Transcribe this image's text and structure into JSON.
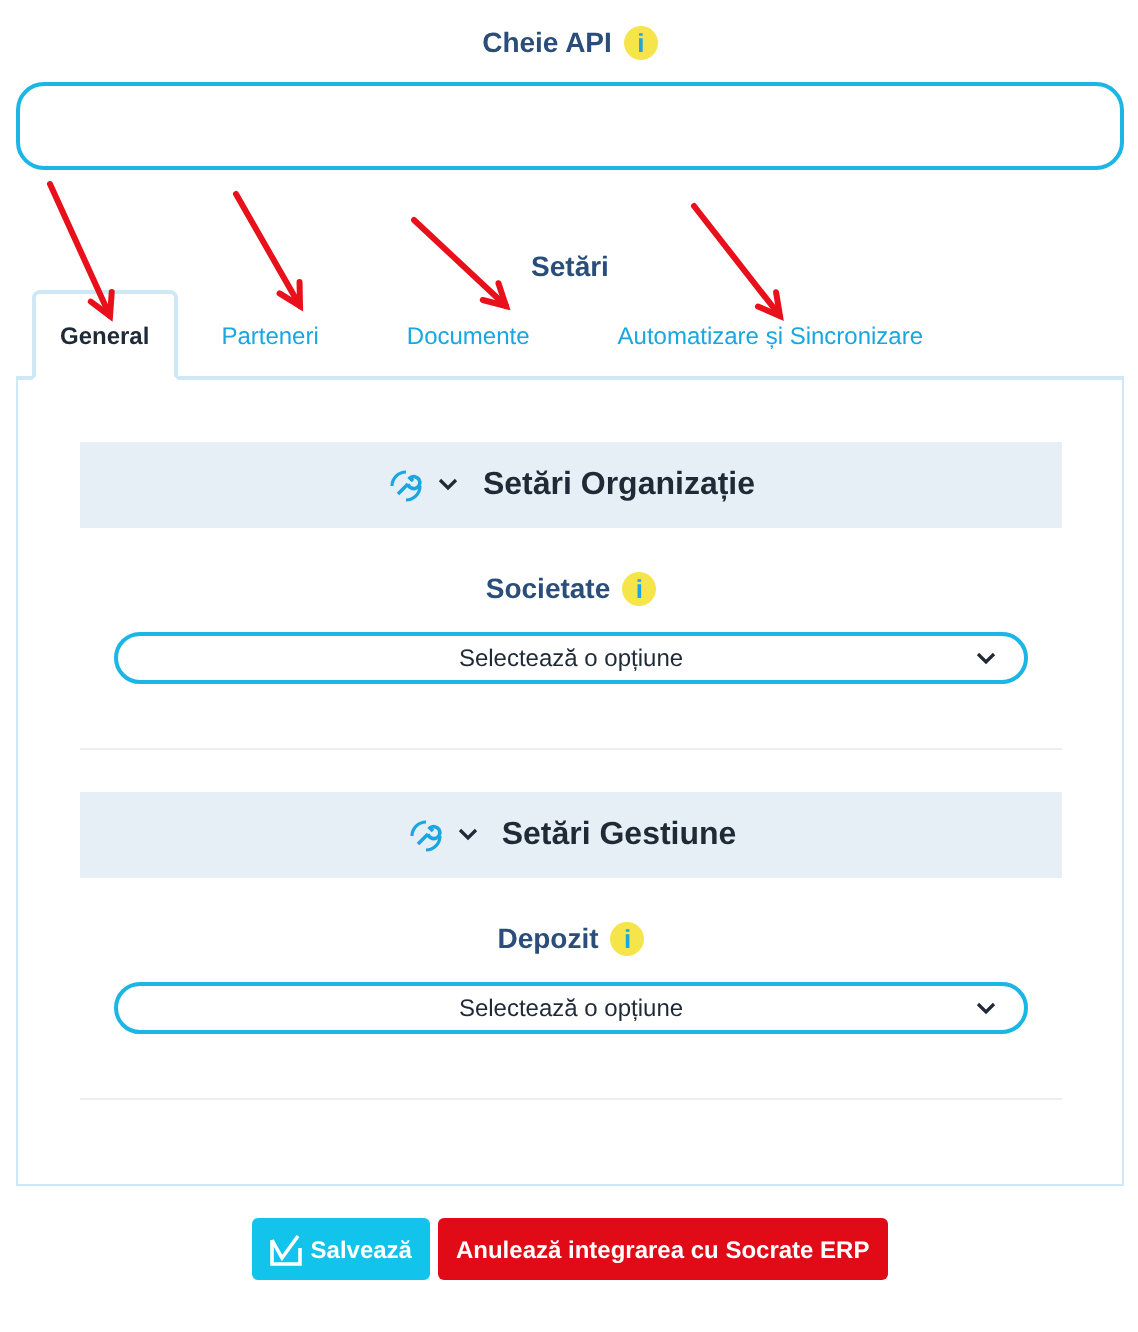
{
  "api_key": {
    "label": "Cheie API",
    "info": "i"
  },
  "settings_title": "Setări",
  "tabs": [
    {
      "label": "General",
      "selected": true
    },
    {
      "label": "Parteneri",
      "selected": false
    },
    {
      "label": "Documente",
      "selected": false
    },
    {
      "label": "Automatizare și Sincronizare",
      "selected": false
    }
  ],
  "sections": [
    {
      "title": "Setări Organizație",
      "field": {
        "label": "Societate",
        "info": "i",
        "value": "Selectează o opțiune"
      }
    },
    {
      "title": "Setări Gestiune",
      "field": {
        "label": "Depozit",
        "info": "i",
        "value": "Selectează o opțiune"
      }
    }
  ],
  "buttons": [
    {
      "kind": "save",
      "label": "Salvează"
    },
    {
      "kind": "danger",
      "label": "Anulează integrarea cu Socrate ERP"
    }
  ],
  "annotations": [
    {
      "kind": "arrow"
    },
    {
      "kind": "arrow"
    },
    {
      "kind": "arrow"
    },
    {
      "kind": "arrow"
    }
  ]
}
